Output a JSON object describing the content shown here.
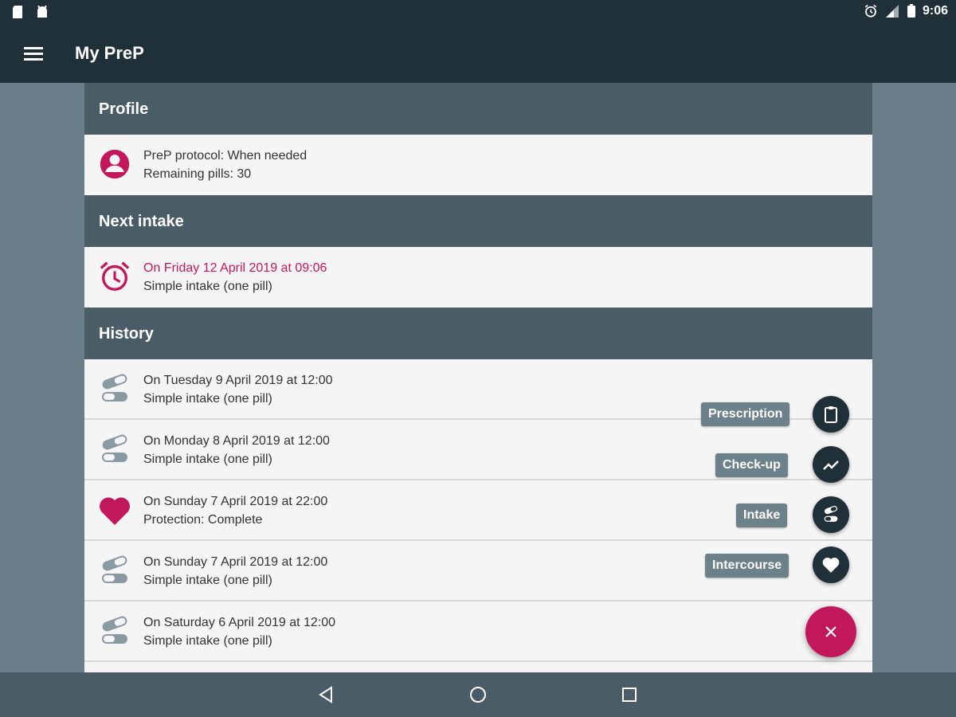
{
  "status_bar": {
    "time": "9:06"
  },
  "app_bar": {
    "title": "My PreP"
  },
  "profile": {
    "header": "Profile",
    "protocol": "PreP protocol: When needed",
    "remaining": "Remaining pills: 30"
  },
  "next_intake": {
    "header": "Next intake",
    "date": "On Friday 12 April 2019 at 09:06",
    "type": "Simple intake (one pill)"
  },
  "history": {
    "header": "History",
    "items": [
      {
        "icon": "pill-icon",
        "date": "On Tuesday 9 April 2019 at 12:00",
        "detail": "Simple intake (one pill)"
      },
      {
        "icon": "pill-icon",
        "date": "On Monday 8 April 2019 at 12:00",
        "detail": "Simple intake (one pill)"
      },
      {
        "icon": "heart-icon",
        "date": "On Sunday 7 April 2019 at 22:00",
        "detail": "Protection: Complete"
      },
      {
        "icon": "pill-icon",
        "date": "On Sunday 7 April 2019 at 12:00",
        "detail": "Simple intake (one pill)"
      },
      {
        "icon": "pill-icon",
        "date": "On Saturday 6 April 2019 at 12:00",
        "detail": "Simple intake (one pill)"
      }
    ]
  },
  "speed_dial": {
    "prescription": "Prescription",
    "checkup": "Check-up",
    "intake": "Intake",
    "intercourse": "Intercourse"
  },
  "colors": {
    "accent": "#c2185b",
    "toolbar": "#1f3038",
    "section_header": "#4a5c66",
    "pill_icon": "#8a9aa3",
    "label_chip": "#6c8189"
  }
}
